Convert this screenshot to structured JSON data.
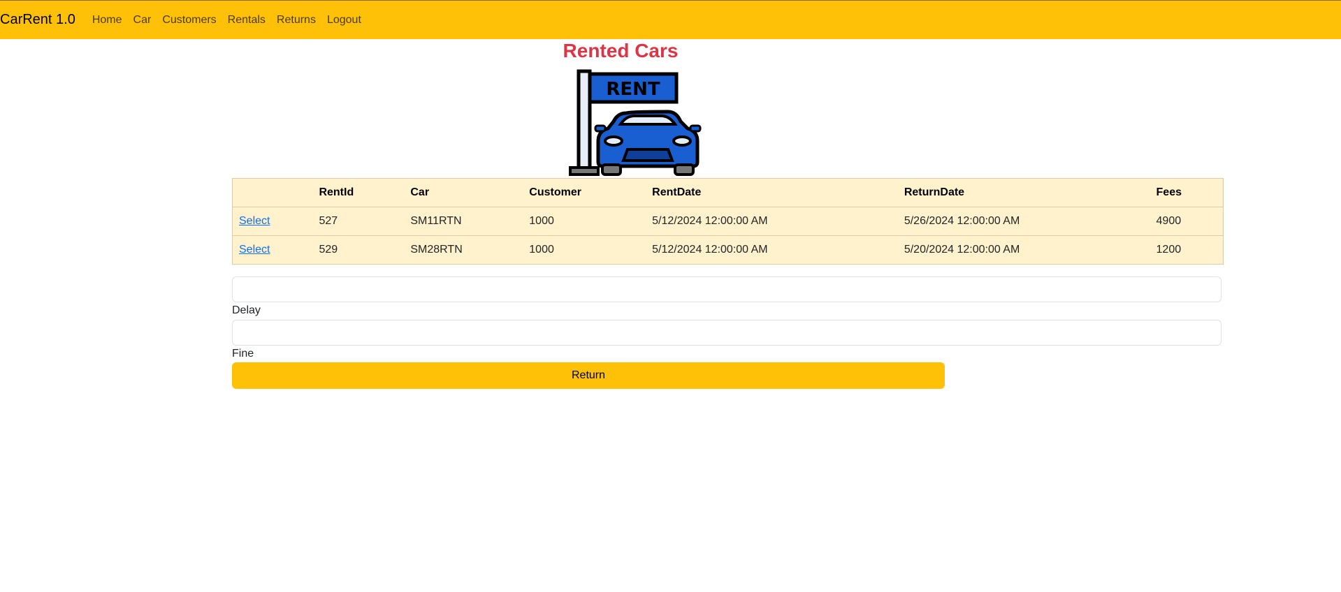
{
  "nav": {
    "brand": "CarRent 1.0",
    "links": [
      "Home",
      "Car",
      "Customers",
      "Rentals",
      "Returns",
      "Logout"
    ]
  },
  "page": {
    "title": "Rented Cars",
    "logo_sign_text": "RENT"
  },
  "table": {
    "headers": [
      "",
      "RentId",
      "Car",
      "Customer",
      "RentDate",
      "ReturnDate",
      "Fees"
    ],
    "rows": [
      [
        "Select",
        "527",
        "SM11RTN",
        "1000",
        "5/12/2024 12:00:00 AM",
        "5/26/2024 12:00:00 AM",
        "4900"
      ],
      [
        "Select",
        "529",
        "SM28RTN",
        "1000",
        "5/12/2024 12:00:00 AM",
        "5/20/2024 12:00:00 AM",
        "1200"
      ]
    ]
  },
  "form": {
    "field1_value": "",
    "delay_label": "Delay",
    "field2_value": "",
    "fine_label": "Fine",
    "return_label": "Return"
  },
  "colors": {
    "accent": "#ffc107",
    "title": "#dc3545",
    "table_bg": "#fff2cc",
    "link": "#0d6efd",
    "car_blue": "#1a5fd1"
  }
}
